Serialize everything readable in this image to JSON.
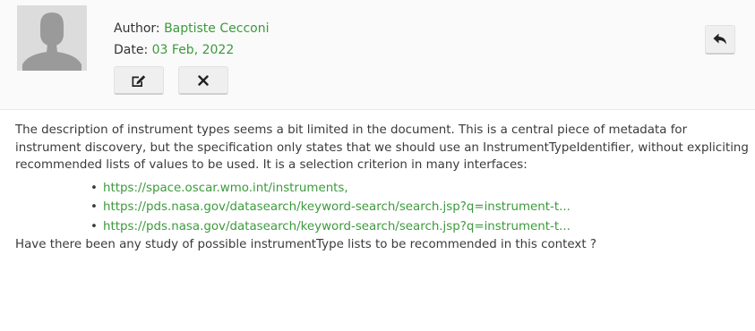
{
  "comment": {
    "author_label": "Author:",
    "author_name": "Baptiste Cecconi",
    "date_label": "Date:",
    "date_value": "03 Feb, 2022",
    "buttons": {
      "edit_icon": "edit-icon",
      "delete_icon": "close-icon",
      "reply_icon": "reply-icon"
    },
    "body": "The description of instrument types seems a bit limited in the document. This is a central piece of metadata for instrument discovery, but the specification only states that we should use an InstrumentTypeIdentifier, without expliciting recommended lists of values to be used. It is a selection criterion in many interfaces:",
    "links": [
      "https://space.oscar.wmo.int/instruments,",
      "https://pds.nasa.gov/datasearch/keyword-search/search.jsp?q=instrument-t...",
      "https://pds.nasa.gov/datasearch/keyword-search/search.jsp?q=instrument-t..."
    ],
    "closing": "Have there been any study of possible instrumentType lists to be recommended in this context ?"
  },
  "colors": {
    "accent_green": "#3c9a3c",
    "text": "#3a3a3a",
    "header_bg": "#fafafa"
  }
}
